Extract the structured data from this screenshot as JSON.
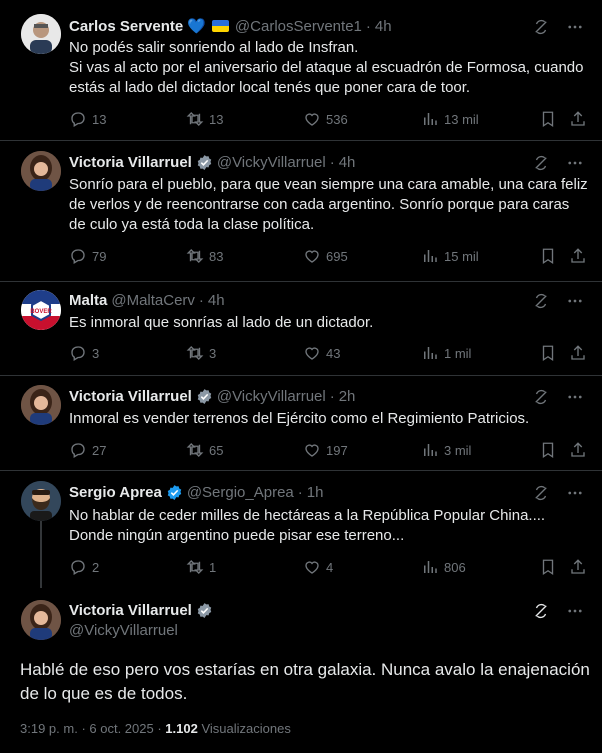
{
  "tweets": [
    {
      "name": "Carlos Servente",
      "handle": "@CarlosServente1",
      "time": "4h",
      "text": "No podés salir sonriendo al lado de Insfran.\nSi vas al acto por el aniversario del ataque al escuadrón de Formosa, cuando estás al lado del dictador local tenés que poner cara de toor.",
      "replies": "13",
      "retweets": "13",
      "likes": "536",
      "views": "13 mil"
    },
    {
      "name": "Victoria Villarruel",
      "handle": "@VickyVillarruel",
      "time": "4h",
      "text": "Sonrío para el pueblo, para que vean siempre una cara amable, una cara feliz de verlos y de reencontrarse con cada argentino. Sonrío porque para caras de culo ya está toda la clase política.",
      "replies": "79",
      "retweets": "83",
      "likes": "695",
      "views": "15 mil"
    },
    {
      "name": "Malta",
      "handle": "@MaltaCerv",
      "time": "4h",
      "text": "Es inmoral que sonrías al lado de un dictador.",
      "replies": "3",
      "retweets": "3",
      "likes": "43",
      "views": "1 mil"
    },
    {
      "name": "Victoria Villarruel",
      "handle": "@VickyVillarruel",
      "time": "2h",
      "text": "Inmoral es vender terrenos del Ejército como el Regimiento Patricios.",
      "replies": "27",
      "retweets": "65",
      "likes": "197",
      "views": "3 mil"
    },
    {
      "name": "Sergio Aprea",
      "handle": "@Sergio_Aprea",
      "time": "1h",
      "text": "No hablar de ceder milles de hectáreas a la República Popular China.... Donde ningún argentino puede pisar ese terreno...",
      "replies": "2",
      "retweets": "1",
      "likes": "4",
      "views": "806"
    }
  ],
  "main": {
    "name": "Victoria Villarruel",
    "handle": "@VickyVillarruel",
    "text": "Hablé de eso pero vos estarías en otra galaxia. Nunca avalo la enajenación de lo que es de todos.",
    "time": "3:19 p. m.",
    "date": "6 oct. 2025",
    "views": "1.102",
    "views_label": "Visualizaciones"
  },
  "colors": {
    "verified": "#1d9bf0",
    "muted": "#71767b",
    "text": "#e7e9ea",
    "background": "#000000"
  }
}
